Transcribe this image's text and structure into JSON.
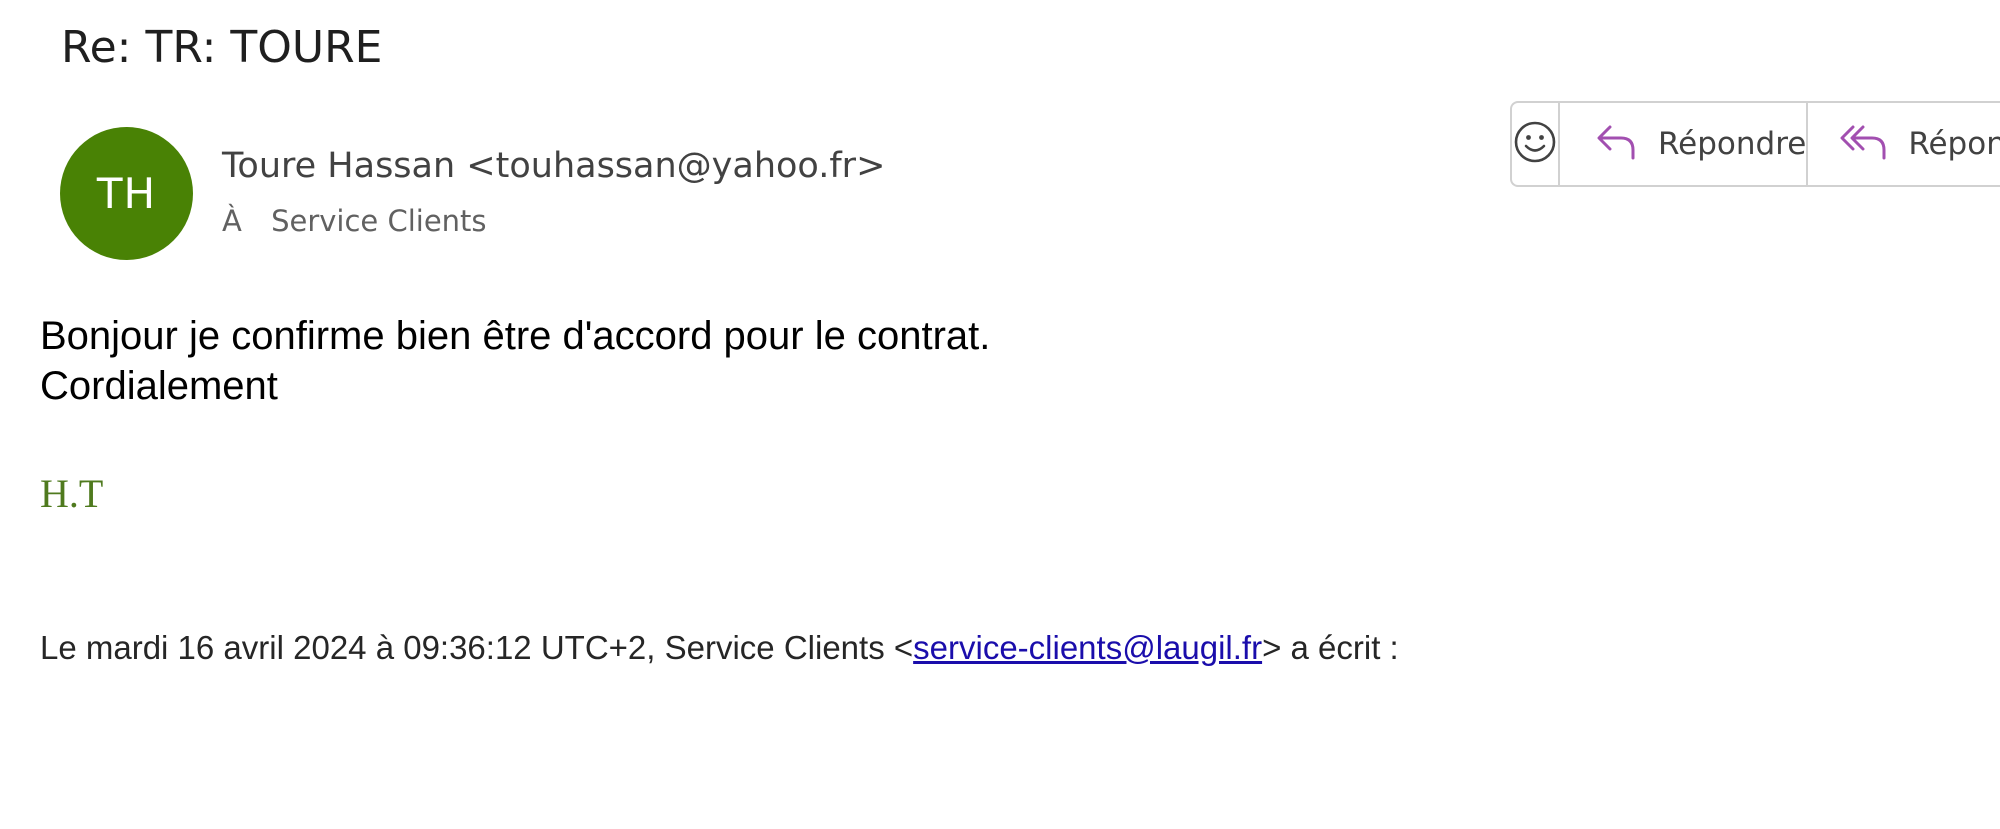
{
  "email": {
    "subject": "Re: TR: TOURE",
    "avatar_initials": "TH",
    "avatar_color": "#498205",
    "sender": "Toure Hassan <touhassan@yahoo.fr>",
    "to_label": "À",
    "to_value": "Service Clients",
    "body_lines": [
      "Bonjour je confirme bien être d'accord pour le contrat.",
      "Cordialement"
    ],
    "signature": "H.T",
    "signature_color": "#4f7a1e",
    "quote": {
      "prefix": "Le mardi 16 avril 2024 à 09:36:12 UTC+2, Service Clients <",
      "link": "service-clients@laugil.fr",
      "suffix": "> a écrit :"
    }
  },
  "toolbar": {
    "emoji_icon": "smiley-icon",
    "reply_icon": "reply-arrow-icon",
    "reply_label": "Répondre",
    "reply_all_icon": "reply-all-arrow-icon",
    "reply_all_label": "Répondre à tous",
    "accent_color": "#a24fb0"
  }
}
